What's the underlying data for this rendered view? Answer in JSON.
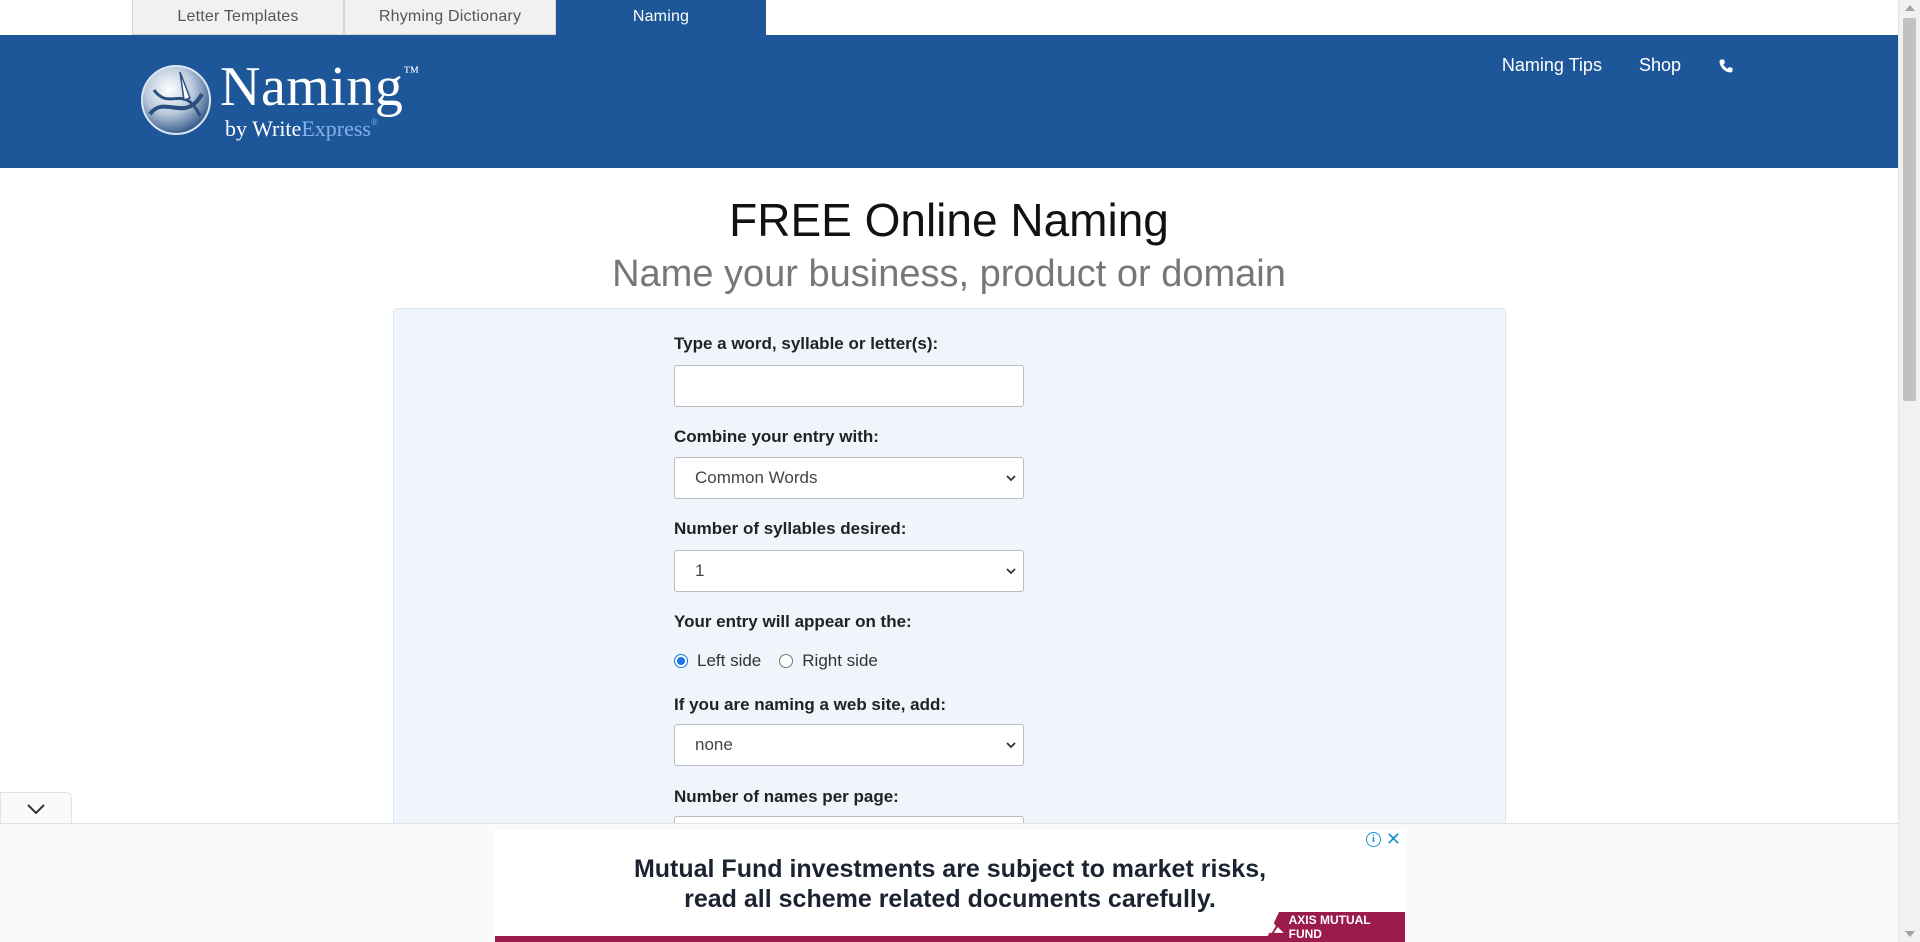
{
  "tabs": [
    {
      "label": "Letter Templates"
    },
    {
      "label": "Rhyming Dictionary"
    },
    {
      "label": "Naming"
    }
  ],
  "header": {
    "logo_word": "Naming",
    "logo_tm": "™",
    "logo_by": "by ",
    "logo_write": "Write",
    "logo_express": "Express",
    "logo_reg": "®",
    "nav": [
      {
        "label": "Naming Tips"
      },
      {
        "label": "Shop"
      }
    ],
    "phone_icon": "phone-icon"
  },
  "main": {
    "title": "FREE Online Naming",
    "subtitle": "Name your business, product or domain"
  },
  "form": {
    "word_label": "Type a word, syllable or letter(s):",
    "word_value": "",
    "combine_label": "Combine your entry with:",
    "combine_value": "Common Words",
    "syllables_label": "Number of syllables desired:",
    "syllables_value": "1",
    "position_label": "Your entry will appear on the:",
    "position_options": [
      "Left side",
      "Right side"
    ],
    "position_selected": "Left side",
    "website_label": "If you are naming a web site, add:",
    "website_value": "none",
    "per_page_label": "Number of names per page:"
  },
  "ad": {
    "line1": "Mutual Fund investments are subject to market risks,",
    "line2": "read all scheme related documents carefully.",
    "brand": "AXIS MUTUAL FUND",
    "info_icon": "info-icon",
    "close_icon": "close-icon"
  },
  "colors": {
    "brand_blue": "#1e5799",
    "panel_bg": "#eff5fb",
    "ad_magenta": "#9b1b4b"
  }
}
